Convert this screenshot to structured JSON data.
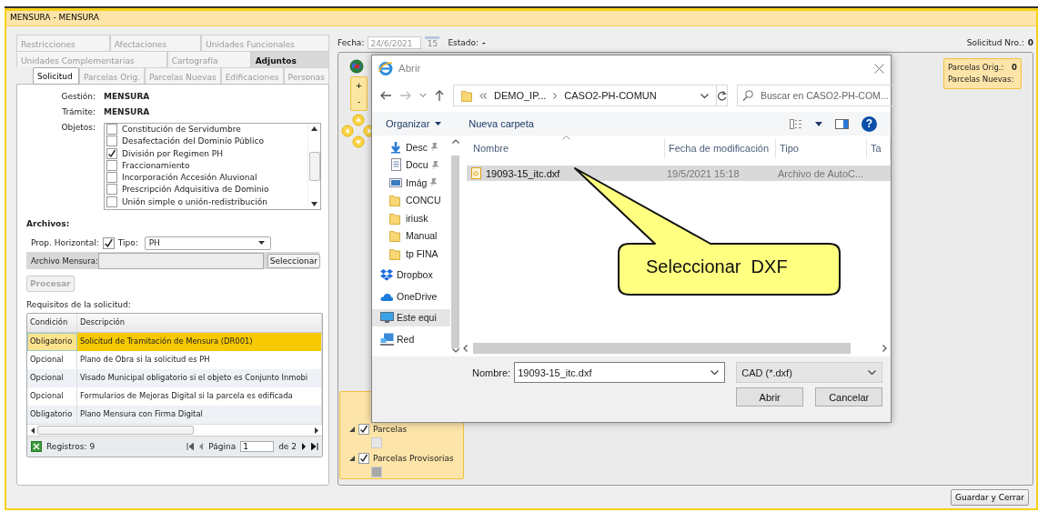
{
  "window": {
    "title": "MENSURA - MENSURA"
  },
  "tab_rows": [
    [
      {
        "label": "Restricciones",
        "selected": false,
        "hovered": false
      },
      {
        "label": "Afectaciones",
        "selected": false,
        "hovered": false
      },
      {
        "label": "Unidades Funcionales",
        "selected": false,
        "hovered": false
      }
    ],
    [
      {
        "label": "Unidades Complementarias",
        "selected": false,
        "hovered": false
      },
      {
        "label": "Cartografía",
        "selected": false,
        "hovered": false
      },
      {
        "label": "Adjuntos",
        "selected": false,
        "hovered": true
      }
    ],
    [
      {
        "label": "Solicitud",
        "selected": true,
        "hovered": false
      },
      {
        "label": "Parcelas Orig.",
        "selected": false,
        "hovered": false
      },
      {
        "label": "Parcelas Nuevas",
        "selected": false,
        "hovered": false
      },
      {
        "label": "Edificaciones",
        "selected": false,
        "hovered": false
      },
      {
        "label": "Personas",
        "selected": false,
        "hovered": false
      }
    ]
  ],
  "gestion": {
    "label": "Gestión:",
    "value": "MENSURA"
  },
  "tramite": {
    "label": "Trámite:",
    "value": "MENSURA"
  },
  "objetos": {
    "label": "Objetos:",
    "items": [
      {
        "label": "Constitución de Servidumbre",
        "checked": false
      },
      {
        "label": "Desafectación del Dominio Público",
        "checked": false
      },
      {
        "label": "División por Regimen PH",
        "checked": true
      },
      {
        "label": "Fraccionamiento",
        "checked": false
      },
      {
        "label": "Incorporación Accesión Aluvional",
        "checked": false
      },
      {
        "label": "Prescripción Adquisitiva de Dominio",
        "checked": false
      },
      {
        "label": "Unión simple o unión-redistribución",
        "checked": false
      }
    ]
  },
  "archivos": {
    "heading": "Archivos:",
    "prop_horizontal": {
      "label": "Prop. Horizontal:",
      "checked": true
    },
    "tipo": {
      "label": "Tipo:",
      "value": "PH"
    },
    "archivo_mensura": {
      "label": "Archivo Mensura:"
    },
    "select_button": "Seleccionar"
  },
  "procesar": {
    "label": "Procesar",
    "disabled": true
  },
  "requisitos": {
    "title": "Requisitos de la solicitud:",
    "columns": [
      "Condición",
      "Descripción"
    ],
    "rows": [
      {
        "condicion": "Obligatorio",
        "descripcion": "Solicitud de Tramitación de Mensura (DR001)",
        "selected": true
      },
      {
        "condicion": "Opcional",
        "descripcion": "Plano de Obra si la solicitud es PH",
        "selected": false
      },
      {
        "condicion": "Opcional",
        "descripcion": "Visado Municipal obligatorio si el objeto es Conjunto Inmobi",
        "selected": false
      },
      {
        "condicion": "Opcional",
        "descripcion": "Formularios de Mejoras Digital si la parcela es edificada",
        "selected": false
      },
      {
        "condicion": "Obligatorio",
        "descripcion": "Plano Mensura con Firma Digital",
        "selected": false
      }
    ],
    "records": "Registros: 9",
    "page_label": "Página",
    "page": "1",
    "page_total": "de 2"
  },
  "header": {
    "fecha_label": "Fecha:",
    "fecha": "24/6/2021",
    "calendar_day": "15",
    "estado_label": "Estado:",
    "estado": "-",
    "solicitud_label": "Solicitud Nro.:",
    "solicitud": "0"
  },
  "map": {
    "zoom_in": "+",
    "zoom_out": "-",
    "info": {
      "orig_label": "Parcelas Orig.:",
      "orig": "0",
      "nuevas_label": "Parcelas Nuevas:"
    },
    "layers": [
      {
        "label": "Parcelas",
        "checked": true,
        "expanded": true,
        "color": "#e6e6e6"
      },
      {
        "label": "Parcelas Provisorias",
        "checked": true,
        "expanded": true,
        "color": "#a8a8a8"
      }
    ]
  },
  "dialog": {
    "title": "Abrir",
    "path": [
      "DEMO_IP...",
      "CASO2-PH-COMUN"
    ],
    "search_placeholder": "Buscar en CASO2-PH-COM...",
    "organize": "Organizar",
    "new_folder": "Nueva carpeta",
    "help": "?",
    "nav": [
      {
        "label": "Desc",
        "kind": "download",
        "pinned": true,
        "selected": false
      },
      {
        "label": "Docu",
        "kind": "document",
        "pinned": true,
        "selected": false
      },
      {
        "label": "Imág",
        "kind": "image",
        "pinned": true,
        "selected": false
      },
      {
        "label": "CONCU",
        "kind": "folder",
        "pinned": false,
        "selected": false
      },
      {
        "label": "iriusk",
        "kind": "folder",
        "pinned": false,
        "selected": false
      },
      {
        "label": "Manual",
        "kind": "folder",
        "pinned": false,
        "selected": false
      },
      {
        "label": "tp FINA",
        "kind": "folder",
        "pinned": false,
        "selected": false
      },
      {
        "label": "Dropbox",
        "kind": "dropbox",
        "pinned": false,
        "selected": false
      },
      {
        "label": "OneDrive",
        "kind": "cloud",
        "pinned": false,
        "selected": false
      },
      {
        "label": "Este equi",
        "kind": "computer",
        "pinned": false,
        "selected": true
      },
      {
        "label": "Red",
        "kind": "network",
        "pinned": false,
        "selected": false
      }
    ],
    "columns": [
      "Nombre",
      "Fecha de modificación",
      "Tipo",
      "Ta"
    ],
    "files": [
      {
        "name": "19093-15_itc.dxf",
        "date": "19/5/2021 15:18",
        "type": "Archivo de AutoC...",
        "selected": true
      }
    ],
    "name_label": "Nombre:",
    "name_value": "19093-15_itc.dxf",
    "filter": "CAD (*.dxf)",
    "open": "Abrir",
    "cancel": "Cancelar"
  },
  "callout": "Seleccionar  DXF",
  "save_button": "Guardar y Cerrar"
}
